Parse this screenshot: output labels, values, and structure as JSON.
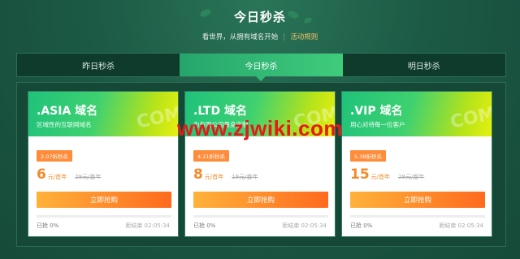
{
  "header": {
    "title": "今日秒杀",
    "subtitle": "看世界，从拥有域名开始",
    "rules_link": "活动规则"
  },
  "tabs": [
    {
      "label": "昨日秒杀",
      "active": false
    },
    {
      "label": "今日秒杀",
      "active": true
    },
    {
      "label": "明日秒杀",
      "active": false
    }
  ],
  "cards": [
    {
      "name": ".ASIA 域名",
      "desc": "区域性的互联网域名",
      "discount": "2.07折秒杀",
      "price": "6",
      "unit": "元/首年",
      "original": "29元/首年",
      "buy_label": "立即抢购",
      "sold_label": "已抢 0%",
      "sold_fraction": 0,
      "countdown": "距结束 02:05:34",
      "watermark": "COM"
    },
    {
      "name": ".LTD 域名",
      "desc": "为有限公司量身定制",
      "discount": "4.21折秒杀",
      "price": "8",
      "unit": "元/首年",
      "original": "19元/首年",
      "buy_label": "立即抢购",
      "sold_label": "已抢 0%",
      "sold_fraction": 0,
      "countdown": "距结束 02:05:34",
      "watermark": "COM"
    },
    {
      "name": ".VIP 域名",
      "desc": "用心对待每一位客户",
      "discount": "5.38折秒杀",
      "price": "15",
      "unit": "元/首年",
      "original": "29元/首年",
      "buy_label": "立即抢购",
      "sold_label": "已抢 0%",
      "sold_fraction": 0,
      "countdown": "距结束 02:05:34",
      "watermark": "COM"
    }
  ],
  "overlay_watermark": "www.zjwiki.com",
  "colors": {
    "background": "#1c5a45",
    "accent_green": "#32b874",
    "orange": "#ff8c3a",
    "watermark_red": "#e81818"
  }
}
